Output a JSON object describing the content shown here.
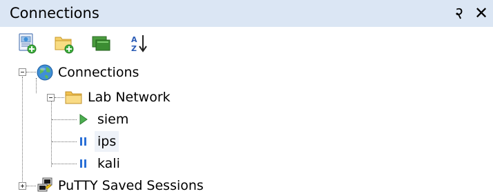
{
  "panel": {
    "title": "Connections",
    "pin_glyph": "२",
    "close_glyph": "✕"
  },
  "toolbar": {
    "buttons": [
      {
        "icon": "new-connection-icon"
      },
      {
        "icon": "new-folder-icon"
      },
      {
        "icon": "screens-icon"
      },
      {
        "icon": "sort-az-icon"
      }
    ]
  },
  "tree": {
    "root": {
      "label": "Connections",
      "icon": "globe-icon",
      "expanded": true,
      "children": [
        {
          "label": "Lab Network",
          "icon": "folder-icon",
          "expanded": true,
          "children": [
            {
              "label": "siem",
              "icon": "connected-play-icon",
              "status": "connected"
            },
            {
              "label": "ips",
              "icon": "disconnected-pause-icon",
              "status": "disconnected"
            },
            {
              "label": "kali",
              "icon": "disconnected-pause-icon",
              "status": "disconnected"
            }
          ]
        }
      ]
    },
    "putty": {
      "label": "PuTTY Saved Sessions",
      "icon": "putty-icon",
      "expanded": false
    }
  },
  "colors": {
    "titlebar_bg": "#dbe6f4",
    "connected": "#4caf50",
    "disconnected": "#2a6fd6",
    "folder": "#f2c14e"
  }
}
